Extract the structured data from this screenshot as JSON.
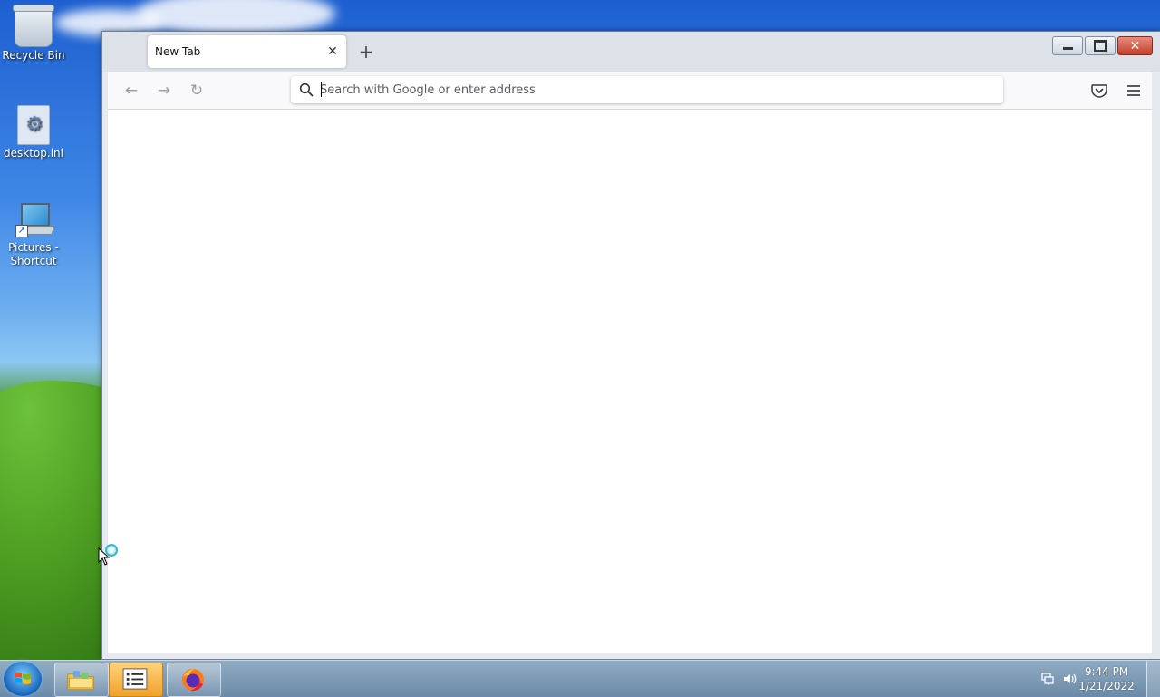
{
  "desktop": {
    "icons": [
      {
        "label": "Recycle Bin",
        "icon": "recycle-bin-icon"
      },
      {
        "label": "desktop.ini",
        "icon": "settings-file-icon"
      },
      {
        "label": "Pictures -\nShortcut",
        "icon": "pictures-shortcut-icon"
      }
    ]
  },
  "browser": {
    "tab": {
      "title": "New Tab",
      "close_symbol": "✕"
    },
    "new_tab_symbol": "+",
    "nav": {
      "back": "←",
      "forward": "→",
      "reload": "↻"
    },
    "urlbar": {
      "placeholder": "Search with Google or enter address",
      "value": ""
    },
    "window_buttons": {
      "close_symbol": "✕"
    }
  },
  "taskbar": {
    "clock": {
      "time": "9:44 PM",
      "date": "1/21/2022"
    }
  },
  "colors": {
    "titlebar": "#dde2e9",
    "toolbar": "#f9f9fb",
    "close_button": "#c2412c",
    "taskbar_active": "#f0a12a"
  }
}
